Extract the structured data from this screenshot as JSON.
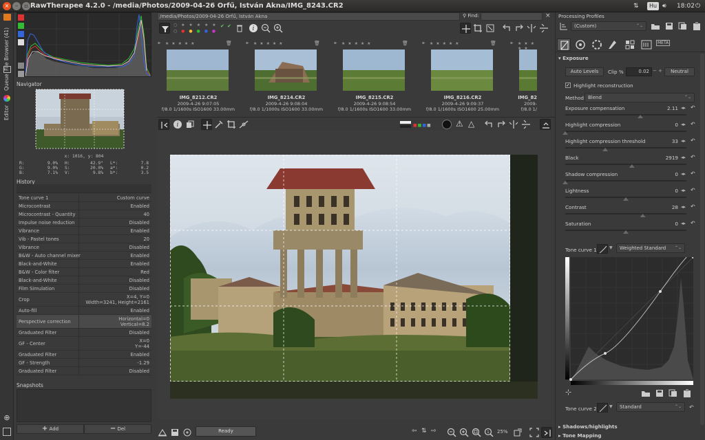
{
  "window": {
    "title": "RawTherapee 4.2.0 - /media/Photos/2009-04-26 Orfű, István Akna/IMG_8243.CR2",
    "tray": {
      "keyboard": "Hu",
      "time": "18:02"
    }
  },
  "side_tabs": {
    "file_browser": "File Browser (41)",
    "queue": "Queue",
    "editor": "Editor"
  },
  "left": {
    "navigator_label": "Navigator",
    "coords": "x: 1016, y: 804",
    "readout": {
      "rgb": [
        "R:",
        "9.0%",
        "G:",
        "9.0%",
        "B:",
        "7.1%"
      ],
      "hsv": [
        "H:",
        "42.9°",
        "S:",
        "20.0%",
        "V:",
        "9.8%"
      ],
      "lab": [
        "L*:",
        "7.8",
        "a*:",
        "0.2",
        "b*:",
        "3.5"
      ]
    },
    "history_label": "History",
    "history": [
      {
        "label": "Tone curve 1",
        "value": "Custom curve"
      },
      {
        "label": "Microcontrast",
        "value": "Enabled"
      },
      {
        "label": "Microcontrast - Quantity",
        "value": "40"
      },
      {
        "label": "Impulse noise reduction",
        "value": "Disabled"
      },
      {
        "label": "Vibrance",
        "value": "Enabled"
      },
      {
        "label": "Vib - Pastel tones",
        "value": "20"
      },
      {
        "label": "Vibrance",
        "value": "Disabled"
      },
      {
        "label": "B&W - Auto channel mixer",
        "value": "Enabled"
      },
      {
        "label": "Black-and-White",
        "value": "Enabled"
      },
      {
        "label": "B&W - Color filter",
        "value": "Red"
      },
      {
        "label": "Black-and-White",
        "value": "Disabled"
      },
      {
        "label": "Film Simulation",
        "value": "Disabled"
      },
      {
        "label": "Crop",
        "value": "X=4, Y=0",
        "value2": "Width=3241, Height=2161"
      },
      {
        "label": "Auto-fill",
        "value": "Enabled"
      },
      {
        "label": "Perspective correction",
        "value": "Horizontal=0",
        "value2": "Vertical=8.2"
      },
      {
        "label": "Graduated Filter",
        "value": "Disabled"
      },
      {
        "label": "GF - Center",
        "value": "X=0",
        "value2": "Y=-44"
      },
      {
        "label": "Graduated Filter",
        "value": "Enabled"
      },
      {
        "label": "GF - Strength",
        "value": "-1.29"
      },
      {
        "label": "Graduated Filter",
        "value": "Disabled"
      }
    ],
    "snapshots_label": "Snapshots",
    "add_label": "Add",
    "del_label": "Del"
  },
  "center": {
    "path": "/media/Photos/2009-04-26 Orfű, István Akna",
    "find_label": "Find:",
    "thumbs": [
      {
        "name": "IMG_8212.CR2",
        "date": "2009-4-26 9:07:05",
        "exif": "f/8.0 1/1600s ISO1600 33.00mm"
      },
      {
        "name": "IMG_8214.CR2",
        "date": "2009-4-26 9:08:04",
        "exif": "f/8.0 1/1000s ISO1600 33.00mm"
      },
      {
        "name": "IMG_8215.CR2",
        "date": "2009-4-26 9:08:54",
        "exif": "f/8.0 1/1600s ISO1600 33.00mm"
      },
      {
        "name": "IMG_8216.CR2",
        "date": "2009-4-26 9:09:37",
        "exif": "f/8.0 1/1600s ISO1600 25.00mm"
      },
      {
        "name": "IMG_82",
        "date": "2009-",
        "exif": "f/8.0 1/"
      }
    ],
    "status": "Ready",
    "zoom": "25%"
  },
  "right": {
    "profiles_label": "Processing Profiles",
    "profile_value": "(Custom)",
    "exposure_label": "Exposure",
    "auto_levels": "Auto Levels",
    "clip_label": "Clip %",
    "clip_value": "0.02",
    "neutral": "Neutral",
    "highlight_reconstruction": "Highlight reconstruction",
    "method_label": "Method:",
    "method_value": "Blend",
    "sliders": [
      {
        "label": "Exposure compensation",
        "value": "2.11",
        "pos": 0.62
      },
      {
        "label": "Highlight compression",
        "value": "0",
        "pos": 0.0
      },
      {
        "label": "Highlight compression threshold",
        "value": "33",
        "pos": 0.33
      },
      {
        "label": "Black",
        "value": "2919",
        "pos": 0.55
      },
      {
        "label": "Shadow compression",
        "value": "0",
        "pos": 0.0
      },
      {
        "label": "Lightness",
        "value": "0",
        "pos": 0.5
      },
      {
        "label": "Contrast",
        "value": "28",
        "pos": 0.64
      },
      {
        "label": "Saturation",
        "value": "0",
        "pos": 0.5
      }
    ],
    "tone_curve1_label": "Tone curve 1:",
    "tone_curve1_value": "Weighted Standard",
    "tone_curve2_label": "Tone curve 2:",
    "tone_curve2_value": "Standard",
    "shadows_highlights": "Shadows/highlights",
    "tone_mapping": "Tone Mapping",
    "meta_label": "META"
  },
  "colors": {
    "accent": "#e08a1e",
    "bg": "#3a3a3a",
    "panel_dark": "#2a2a2a"
  }
}
